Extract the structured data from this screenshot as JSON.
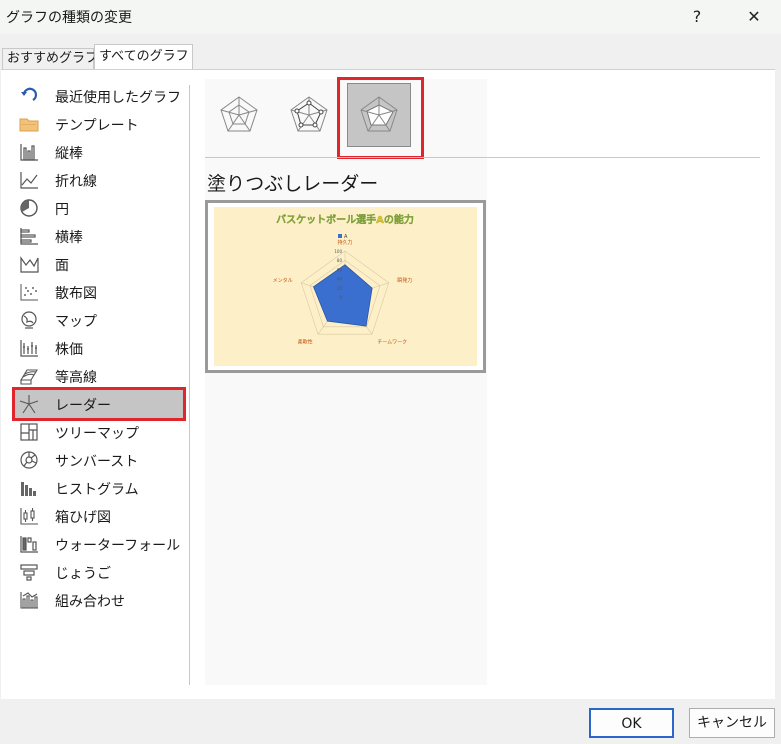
{
  "dialog": {
    "title": "グラフの種類の変更",
    "help": "?",
    "close": "✕"
  },
  "tabs": [
    {
      "label": "おすすめグラフ"
    },
    {
      "label": "すべてのグラフ"
    }
  ],
  "categories": [
    {
      "label": "最近使用したグラフ",
      "icon": "recent-icon"
    },
    {
      "label": "テンプレート",
      "icon": "folder-icon"
    },
    {
      "label": "縦棒",
      "icon": "column-chart-icon"
    },
    {
      "label": "折れ線",
      "icon": "line-chart-icon"
    },
    {
      "label": "円",
      "icon": "pie-chart-icon"
    },
    {
      "label": "横棒",
      "icon": "bar-chart-icon"
    },
    {
      "label": "面",
      "icon": "area-chart-icon"
    },
    {
      "label": "散布図",
      "icon": "scatter-chart-icon"
    },
    {
      "label": "マップ",
      "icon": "map-chart-icon"
    },
    {
      "label": "株価",
      "icon": "stock-chart-icon"
    },
    {
      "label": "等高線",
      "icon": "surface-chart-icon"
    },
    {
      "label": "レーダー",
      "icon": "radar-chart-icon"
    },
    {
      "label": "ツリーマップ",
      "icon": "treemap-chart-icon"
    },
    {
      "label": "サンバースト",
      "icon": "sunburst-chart-icon"
    },
    {
      "label": "ヒストグラム",
      "icon": "histogram-chart-icon"
    },
    {
      "label": "箱ひげ図",
      "icon": "box-whisker-chart-icon"
    },
    {
      "label": "ウォーターフォール",
      "icon": "waterfall-chart-icon"
    },
    {
      "label": "じょうご",
      "icon": "funnel-chart-icon"
    },
    {
      "label": "組み合わせ",
      "icon": "combo-chart-icon"
    }
  ],
  "selected_category": "レーダー",
  "chart_name": "塗りつぶしレーダー",
  "preview": {
    "title": "バスケットボール選手Aの能力",
    "legend": "A",
    "axes": [
      "持久力",
      "瞬発力",
      "チームワーク",
      "柔軟性",
      "メンタル"
    ],
    "ticks": [
      "100",
      "80",
      "60",
      "40",
      "20",
      "0"
    ],
    "values": [
      70,
      62,
      78,
      65,
      72
    ],
    "max": 100,
    "colors": {
      "background": "#fdf0c8",
      "fill": "#3a6fd0",
      "title": "#e8c020",
      "axis_label": "#c05010"
    }
  },
  "buttons": {
    "ok": "OK",
    "cancel": "キャンセル"
  }
}
